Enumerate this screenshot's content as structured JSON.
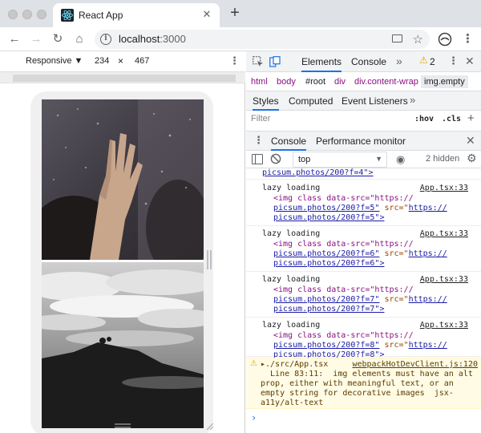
{
  "browser": {
    "tab_title": "React App",
    "tab_close": "✕",
    "new_tab": "+",
    "url_host": "localhost",
    "url_port": ":3000",
    "nav": {
      "back": "←",
      "forward": "→",
      "reload": "↻",
      "home": "⌂"
    },
    "star": "☆",
    "menu": "⋮"
  },
  "device_toolbar": {
    "mode": "Responsive ▼",
    "width": "234",
    "times": "×",
    "height": "467",
    "more": "⋮"
  },
  "devtools": {
    "tabs": [
      "Elements",
      "Console"
    ],
    "active_tab": "Elements",
    "more_tabs": "»",
    "warning_icon": "⚠",
    "warning_count": "2",
    "menu": "⋮",
    "close": "✕",
    "breadcrumbs": [
      "html",
      "body",
      "#root",
      "div",
      "div.content-wrap",
      "img.empty"
    ],
    "styles_tabs": [
      "Styles",
      "Computed",
      "Event Listeners"
    ],
    "styles_more": "»",
    "filter_placeholder": "Filter",
    "hov": ":hov",
    "cls": ".cls",
    "add": "+"
  },
  "drawer": {
    "more": "⋮",
    "tabs": [
      "Console",
      "Performance monitor"
    ],
    "close": "✕"
  },
  "console_toolbar": {
    "context": "top",
    "context_arrow": "▼",
    "eye": "◉",
    "hidden_count": "2 hidden",
    "gear": "⚙"
  },
  "console": {
    "top_partial": "picsum.photos/200?f=4\">",
    "messages": [
      {
        "text": "lazy loading",
        "source": "App.tsx:33",
        "img": "<img class data-src=\"https://",
        "l2a": "picsum.photos/200?f=5\"",
        "l2b": " src=\"",
        "l2c": "https://",
        "l3": "picsum.photos/200?f=5\">"
      },
      {
        "text": "lazy loading",
        "source": "App.tsx:33",
        "img": "<img class data-src=\"https://",
        "l2a": "picsum.photos/200?f=6\"",
        "l2b": " src=\"",
        "l2c": "https://",
        "l3": "picsum.photos/200?f=6\">"
      },
      {
        "text": "lazy loading",
        "source": "App.tsx:33",
        "img": "<img class data-src=\"https://",
        "l2a": "picsum.photos/200?f=7\"",
        "l2b": " src=\"",
        "l2c": "https://",
        "l3": "picsum.photos/200?f=7\">"
      },
      {
        "text": "lazy loading",
        "source": "App.tsx:33",
        "img": "<img class data-src=\"https://",
        "l2a": "picsum.photos/200?f=8\"",
        "l2b": " src=\"",
        "l2c": "https://",
        "l3": "picsum.photos/200?f=8\">"
      }
    ],
    "warning": {
      "icon": "⚠",
      "file": "▸./src/App.tsx",
      "source": "webpackHotDevClient.js:120",
      "line1": "  Line 83:11:  img elements must have an alt",
      "line2": "prop, either with meaningful text, or an",
      "line3": "empty string for decorative images  jsx-",
      "line4": "a11y/alt-text"
    },
    "prompt": "›"
  },
  "colors": {
    "accent": "#1a73e8",
    "warning_bg": "#fffbe5",
    "tag": "#881280"
  }
}
